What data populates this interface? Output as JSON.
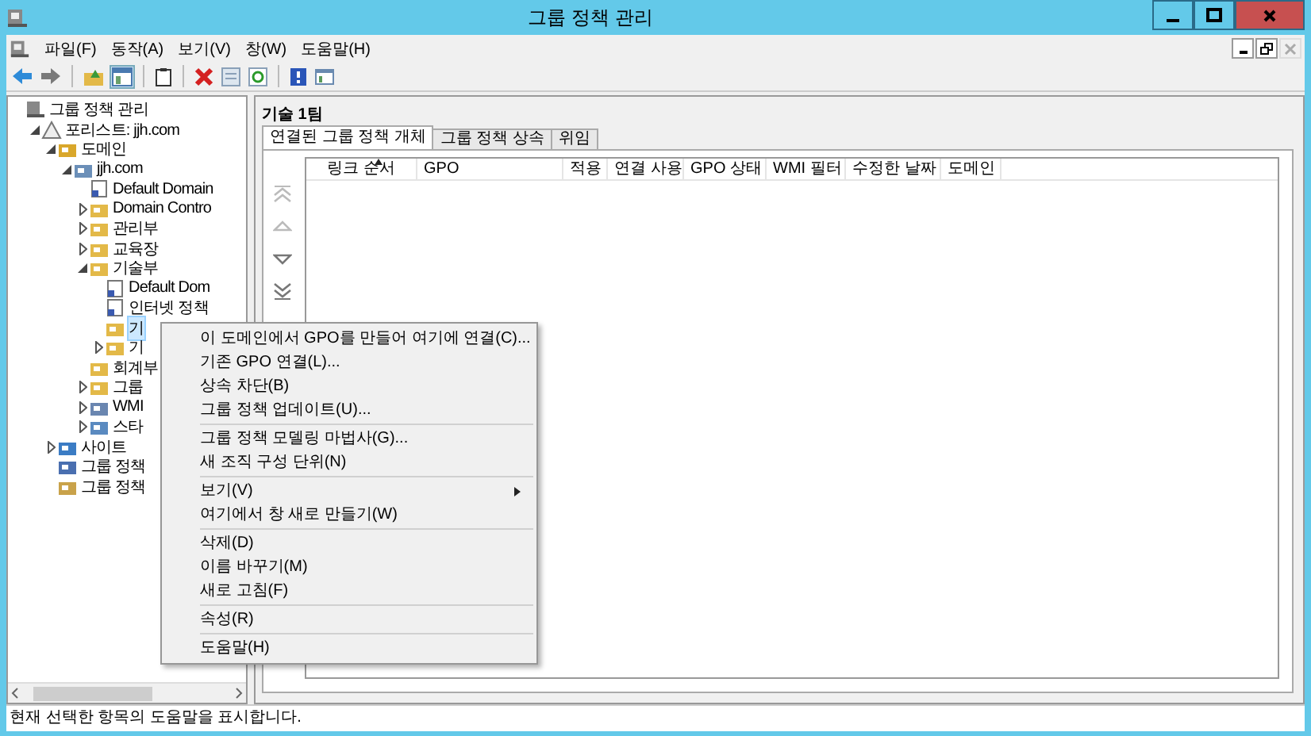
{
  "window": {
    "title": "그룹 정책 관리"
  },
  "menu_bar": [
    "파일(F)",
    "동작(A)",
    "보기(V)",
    "창(W)",
    "도움말(H)"
  ],
  "tree": [
    {
      "label": "그룹 정책 관리",
      "kind": "console",
      "has_toggle": false,
      "selected": false,
      "children": [
        {
          "label": "포리스트: jjh.com",
          "kind": "forest",
          "has_toggle": true,
          "expanded": true,
          "selected": false,
          "children": [
            {
              "label": "도메인",
              "kind": "domains",
              "has_toggle": true,
              "expanded": true,
              "selected": false,
              "children": [
                {
                  "label": "jjh.com",
                  "kind": "domain",
                  "has_toggle": true,
                  "expanded": true,
                  "selected": false,
                  "children": [
                    {
                      "label": "Default Domain",
                      "kind": "gpo",
                      "has_toggle": false,
                      "selected": false
                    },
                    {
                      "label": "Domain Contro",
                      "kind": "ou",
                      "has_toggle": true,
                      "expanded": false,
                      "selected": false
                    },
                    {
                      "label": "관리부",
                      "kind": "ou",
                      "has_toggle": true,
                      "expanded": false,
                      "selected": false
                    },
                    {
                      "label": "교육장",
                      "kind": "ou",
                      "has_toggle": true,
                      "expanded": false,
                      "selected": false
                    },
                    {
                      "label": "기술부",
                      "kind": "ou",
                      "has_toggle": true,
                      "expanded": true,
                      "selected": false,
                      "children": [
                        {
                          "label": "Default Dom",
                          "kind": "gpo",
                          "has_toggle": false,
                          "selected": false
                        },
                        {
                          "label": "인터넷 정책",
                          "kind": "gpo",
                          "has_toggle": false,
                          "selected": false
                        },
                        {
                          "label": "기",
                          "kind": "ou",
                          "has_toggle": false,
                          "selected": true
                        },
                        {
                          "label": "기",
                          "kind": "ou",
                          "has_toggle": true,
                          "expanded": false,
                          "selected": false
                        }
                      ]
                    },
                    {
                      "label": "회계부",
                      "kind": "ou",
                      "has_toggle": false,
                      "selected": false
                    },
                    {
                      "label": "그룹",
                      "kind": "objects",
                      "has_toggle": true,
                      "expanded": false,
                      "selected": false
                    },
                    {
                      "label": "WMI",
                      "kind": "wmi",
                      "has_toggle": true,
                      "expanded": false,
                      "selected": false
                    },
                    {
                      "label": "스타",
                      "kind": "starter",
                      "has_toggle": true,
                      "expanded": false,
                      "selected": false
                    }
                  ]
                }
              ]
            },
            {
              "label": "사이트",
              "kind": "sites",
              "has_toggle": true,
              "expanded": false,
              "selected": false
            },
            {
              "label": "그룹 정책",
              "kind": "modeling",
              "has_toggle": false,
              "selected": false
            },
            {
              "label": "그룹 정책",
              "kind": "results",
              "has_toggle": false,
              "selected": false
            }
          ]
        }
      ]
    }
  ],
  "details": {
    "title": "기술 1팀",
    "tabs": [
      {
        "label": "연결된 그룹 정책 개체",
        "selected": true
      },
      {
        "label": "그룹 정책 상속",
        "selected": false
      },
      {
        "label": "위임",
        "selected": false
      }
    ],
    "columns": [
      "링크 순서",
      "GPO",
      "적용",
      "연결 사용",
      "GPO 상태",
      "WMI 필터",
      "수정한 날짜",
      "도메인"
    ]
  },
  "context_menu": [
    [
      {
        "label": "이 도메인에서 GPO를 만들어 여기에 연결(C)...",
        "submenu": false
      },
      {
        "label": "기존 GPO 연결(L)...",
        "submenu": false
      },
      {
        "label": "상속 차단(B)",
        "submenu": false
      },
      {
        "label": "그룹 정책 업데이트(U)...",
        "submenu": false
      }
    ],
    [
      {
        "label": "그룹 정책 모델링 마법사(G)...",
        "submenu": false
      },
      {
        "label": "새 조직 구성 단위(N)",
        "submenu": false
      }
    ],
    [
      {
        "label": "보기(V)",
        "submenu": true
      },
      {
        "label": "여기에서 창 새로 만들기(W)",
        "submenu": false
      }
    ],
    [
      {
        "label": "삭제(D)",
        "submenu": false
      },
      {
        "label": "이름 바꾸기(M)",
        "submenu": false
      },
      {
        "label": "새로 고침(F)",
        "submenu": false
      }
    ],
    [
      {
        "label": "속성(R)",
        "submenu": false
      }
    ],
    [
      {
        "label": "도움말(H)",
        "submenu": false
      }
    ]
  ],
  "status_bar": "현재 선택한 항목의 도움말을 표시합니다."
}
